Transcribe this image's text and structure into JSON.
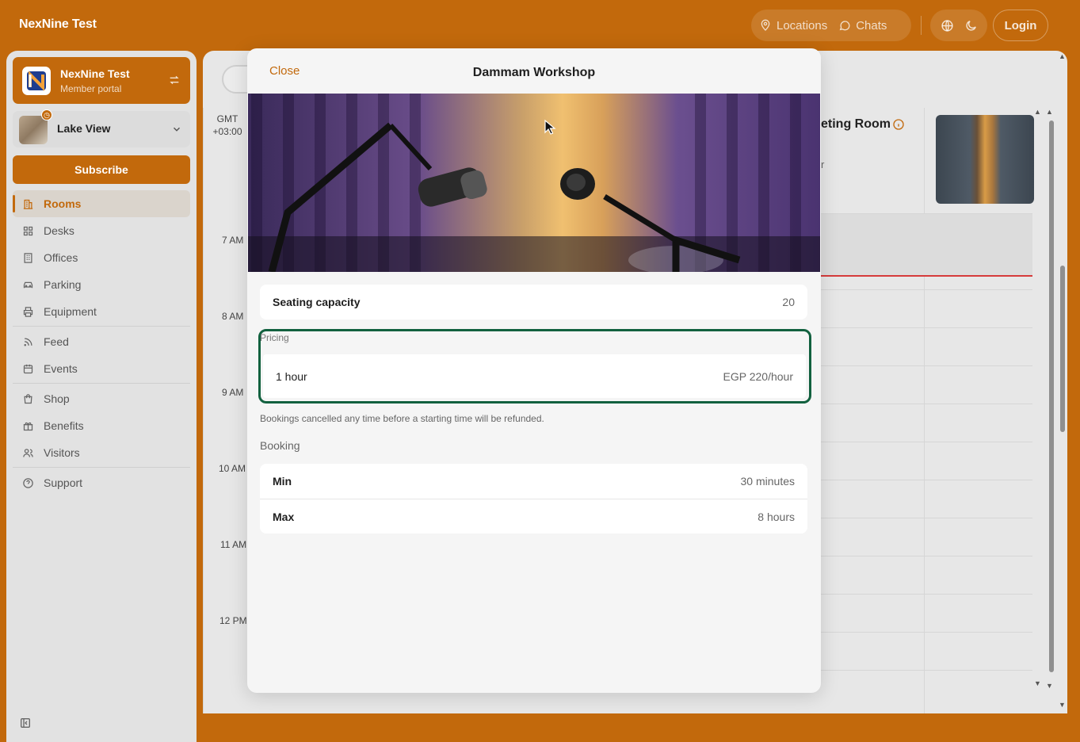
{
  "app": {
    "brand": "NexNine Test",
    "accent_color": "#c2690c"
  },
  "topbar": {
    "locations_label": "Locations",
    "chats_label": "Chats",
    "login_label": "Login"
  },
  "sidebar": {
    "org_name": "NexNine Test",
    "org_subtitle": "Member portal",
    "location_name": "Lake View",
    "subscribe_label": "Subscribe",
    "items": [
      {
        "label": "Rooms",
        "icon": "building-icon",
        "active": true
      },
      {
        "label": "Desks",
        "icon": "grid-icon"
      },
      {
        "label": "Offices",
        "icon": "office-icon"
      },
      {
        "label": "Parking",
        "icon": "car-icon"
      },
      {
        "label": "Equipment",
        "icon": "printer-icon"
      },
      {
        "label": "Feed",
        "icon": "rss-icon"
      },
      {
        "label": "Events",
        "icon": "calendar-icon"
      },
      {
        "label": "Shop",
        "icon": "shopping-bag-icon"
      },
      {
        "label": "Benefits",
        "icon": "gift-icon"
      },
      {
        "label": "Visitors",
        "icon": "users-icon"
      },
      {
        "label": "Support",
        "icon": "help-circle-icon"
      }
    ]
  },
  "calendar": {
    "timezone_line1": "GMT",
    "timezone_line2": "+03:00",
    "hours": [
      "7 AM",
      "8 AM",
      "9 AM",
      "10 AM",
      "11 AM",
      "12 PM"
    ],
    "room_header_visible": "eting Room",
    "room_header_sub_visible": "r"
  },
  "modal": {
    "close_label": "Close",
    "title": "Dammam Workshop",
    "seating": {
      "label": "Seating capacity",
      "value": "20"
    },
    "pricing": {
      "section_label": "Pricing",
      "rows": [
        {
          "label": "1 hour",
          "value": "EGP 220/hour"
        }
      ]
    },
    "refund_note": "Bookings cancelled any time before a starting time will be refunded.",
    "booking": {
      "section_label": "Booking",
      "min": {
        "label": "Min",
        "value": "30 minutes"
      },
      "max": {
        "label": "Max",
        "value": "8 hours"
      }
    },
    "pricing_highlight_color": "#12613f"
  }
}
